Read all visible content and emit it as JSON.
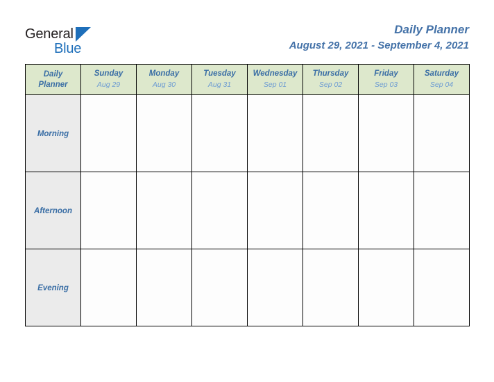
{
  "brand": {
    "name_part1": "General",
    "name_part2": "Blue",
    "logo_icon": "triangle-icon",
    "color_dark": "#231f20",
    "color_blue": "#1e6fba"
  },
  "header": {
    "title": "Daily Planner",
    "date_range": "August 29, 2021 - September 4, 2021",
    "title_color": "#4472a8"
  },
  "table": {
    "corner_label_line1": "Daily",
    "corner_label_line2": "Planner",
    "header_bg": "#dde8cc",
    "row_label_bg": "#ebebeb",
    "cell_bg": "#fdfdfd",
    "border_color": "#000000",
    "day_text_color": "#3a6ea5",
    "date_text_color": "#6c9bd2",
    "columns": [
      {
        "day": "Sunday",
        "date": "Aug 29"
      },
      {
        "day": "Monday",
        "date": "Aug 30"
      },
      {
        "day": "Tuesday",
        "date": "Aug 31"
      },
      {
        "day": "Wednesday",
        "date": "Sep 01"
      },
      {
        "day": "Thursday",
        "date": "Sep 02"
      },
      {
        "day": "Friday",
        "date": "Sep 03"
      },
      {
        "day": "Saturday",
        "date": "Sep 04"
      }
    ],
    "rows": [
      {
        "label": "Morning",
        "cells": [
          "",
          "",
          "",
          "",
          "",
          "",
          ""
        ]
      },
      {
        "label": "Afternoon",
        "cells": [
          "",
          "",
          "",
          "",
          "",
          "",
          ""
        ]
      },
      {
        "label": "Evening",
        "cells": [
          "",
          "",
          "",
          "",
          "",
          "",
          ""
        ]
      }
    ]
  }
}
